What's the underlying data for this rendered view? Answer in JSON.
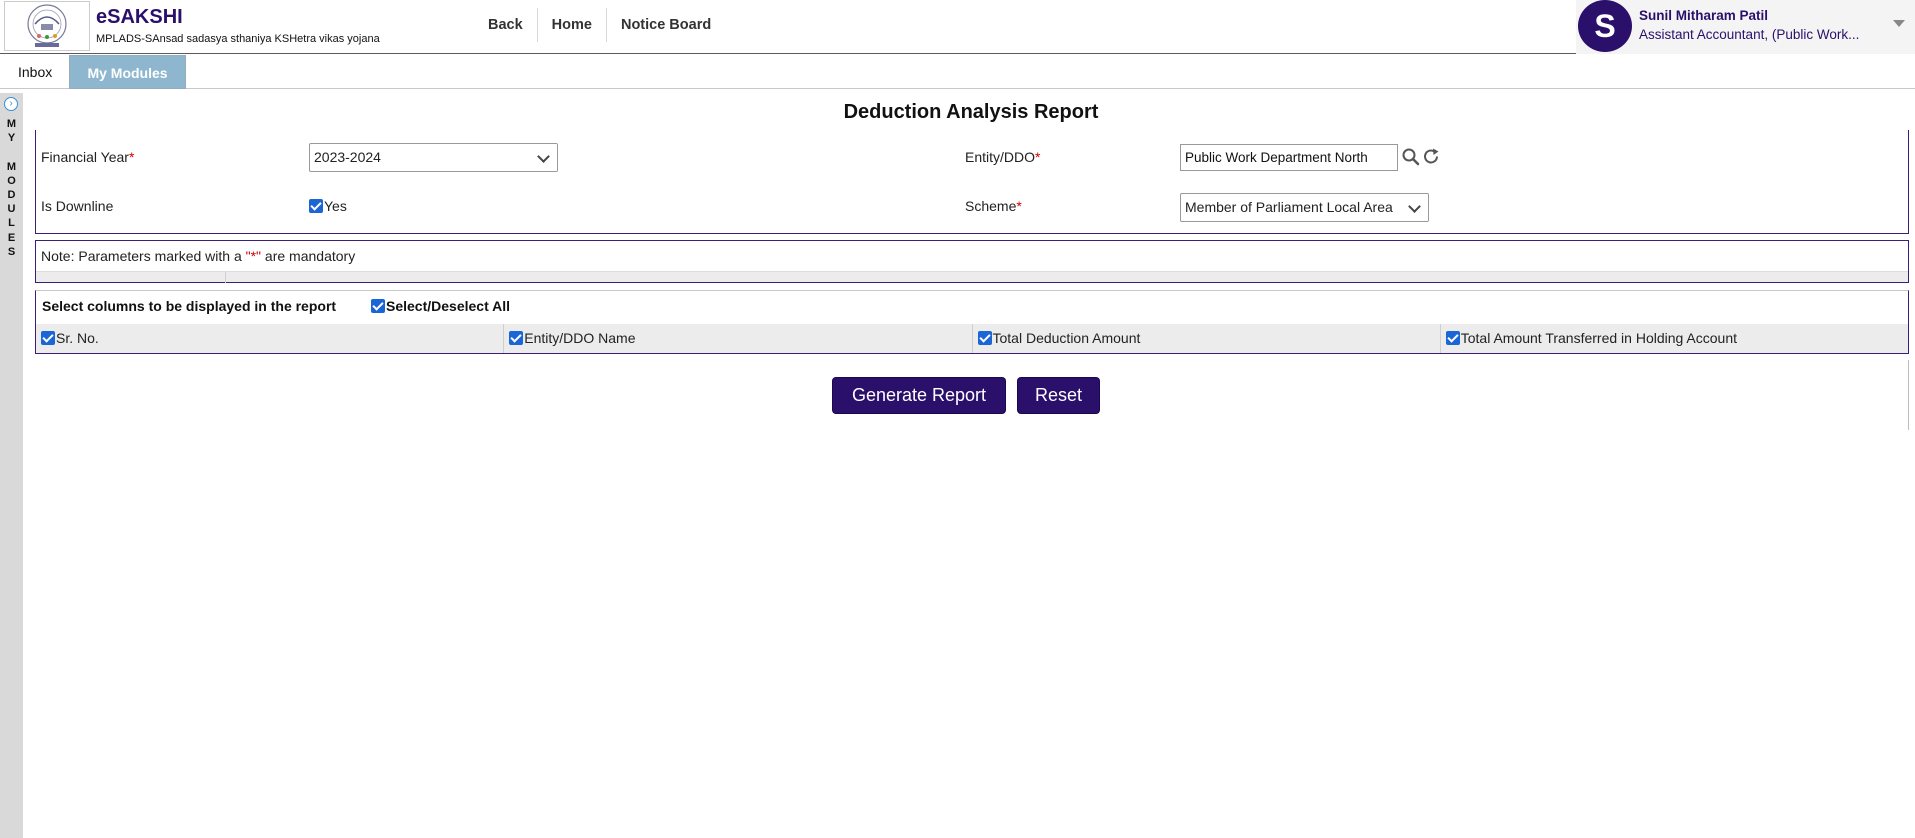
{
  "header": {
    "app_title": "eSAKSHI",
    "app_subtitle": "MPLADS-SAnsad sadasya sthaniya KSHetra vikas yojana",
    "logo_icon": "mplads-emblem-icon",
    "nav": {
      "back": "Back",
      "home": "Home",
      "notice_board": "Notice Board"
    },
    "user": {
      "initial": "S",
      "name": "Sunil Mitharam Patil",
      "role": "Assistant Accountant, (Public Work..."
    }
  },
  "tabs": {
    "inbox": "Inbox",
    "my_modules": "My Modules"
  },
  "sidebar": {
    "label": "MY MODULES"
  },
  "report": {
    "title": "Deduction Analysis Report",
    "financial_year": {
      "label": "Financial Year",
      "required": "*",
      "value": "2023-2024"
    },
    "entity": {
      "label": "Entity/DDO",
      "required": "*",
      "value": "Public Work Department North"
    },
    "downline": {
      "label": "Is Downline",
      "option": "Yes",
      "checked": true
    },
    "scheme": {
      "label": "Scheme",
      "required": "*",
      "value": "Member of Parliament Local Area"
    },
    "note": {
      "prefix": "Note: Parameters marked with a ",
      "marker": "\"*\"",
      "suffix": " are mandatory"
    },
    "columns": {
      "heading": "Select columns to be displayed in the report",
      "select_all": "Select/Deselect All",
      "items": [
        "Sr. No.",
        "Entity/DDO Name",
        "Total Deduction Amount",
        "Total Amount Transferred in Holding Account"
      ]
    },
    "buttons": {
      "generate": "Generate Report",
      "reset": "Reset"
    }
  },
  "colors": {
    "brand": "#2a0f6b",
    "active_tab": "#8eb7cf",
    "required": "#d00000",
    "checkbox": "#1a66d6"
  }
}
